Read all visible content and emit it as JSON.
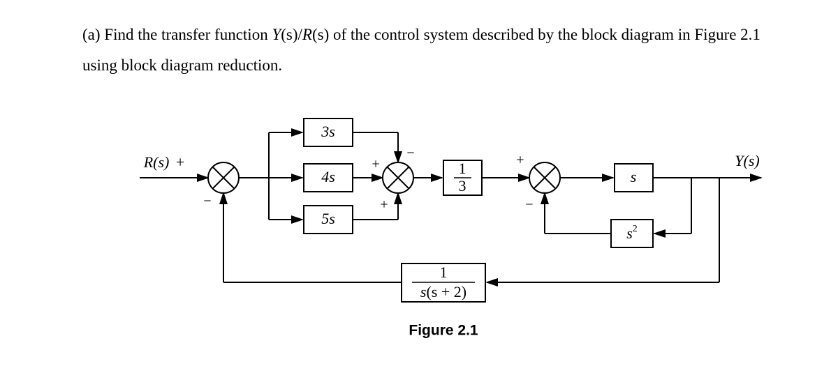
{
  "question": {
    "part_label": "(a)",
    "text_before_ratio": "Find the transfer function ",
    "ratio_Y": "Y",
    "ratio_s1": "(s)",
    "ratio_slash": "/",
    "ratio_R": "R",
    "ratio_s2": "(s)",
    "text_after_ratio": " of the control system described by the block diagram in Figure 2.1 using block diagram reduction."
  },
  "diagram": {
    "input_label": "R(s)",
    "output_label": "Y(s)",
    "block_3s": "3s",
    "block_4s": "4s",
    "block_5s": "5s",
    "block_1over3_num": "1",
    "block_1over3_den": "3",
    "block_s": "s",
    "block_s2_base": "s",
    "block_s2_exp": "2",
    "block_fb_num": "1",
    "block_fb_den_s": "s",
    "block_fb_den_paren": "(s + 2)",
    "sum1_top": "+",
    "sum1_bottom": "−",
    "sum2_top": "−",
    "sum2_left": "+",
    "sum2_bottom": "+",
    "sum3_top": "+",
    "sum3_bottom": "−",
    "caption": "Figure 2.1"
  }
}
